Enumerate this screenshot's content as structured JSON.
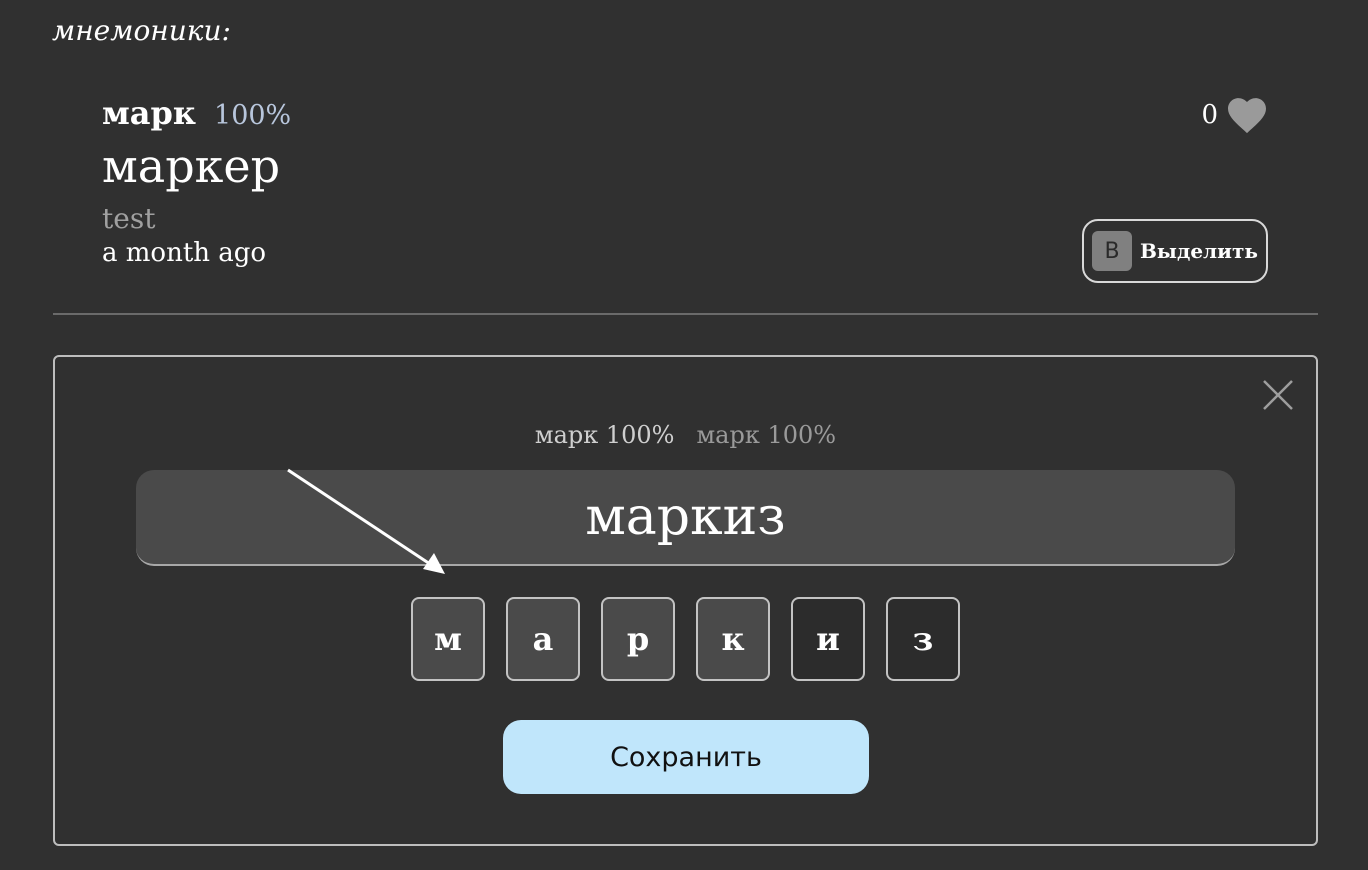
{
  "section": {
    "title": "мнемоники:"
  },
  "entry": {
    "key": "марк",
    "percent": "100%",
    "word": "маркер",
    "author": "test",
    "time": "a month ago",
    "likes": "0",
    "select_key": "B",
    "select_label": "Выделить"
  },
  "editor": {
    "variants": [
      "марк 100%",
      "марк 100%"
    ],
    "word": "маркиз",
    "letters": [
      {
        "char": "м",
        "selected": true
      },
      {
        "char": "а",
        "selected": true
      },
      {
        "char": "р",
        "selected": true
      },
      {
        "char": "к",
        "selected": true
      },
      {
        "char": "и",
        "selected": false
      },
      {
        "char": "з",
        "selected": false
      }
    ],
    "save_label": "Сохранить"
  },
  "colors": {
    "background": "#303030",
    "percent": "#b8c6dc",
    "save_button": "#c0e6fb"
  },
  "icons": [
    "heart-icon",
    "close-icon",
    "arrow-icon"
  ]
}
